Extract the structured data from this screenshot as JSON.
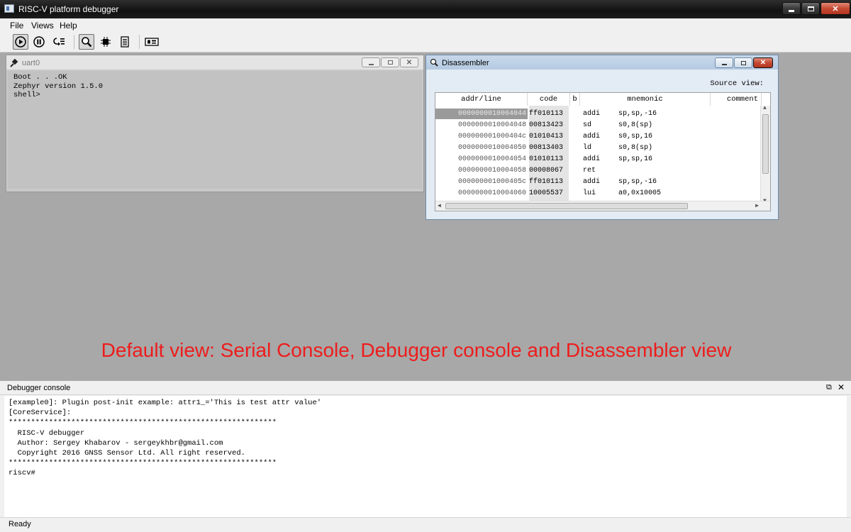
{
  "window": {
    "title": "RISC-V platform debugger"
  },
  "menu": [
    "File",
    "Views",
    "Help"
  ],
  "toolbar": {
    "buttons": [
      {
        "icon": "run-icon",
        "pressed": true
      },
      {
        "icon": "pause-icon",
        "pressed": false
      },
      {
        "icon": "step-into-icon",
        "pressed": false
      },
      {
        "icon": "magnifier-icon",
        "pressed": true
      },
      {
        "icon": "cpu-chip-icon",
        "pressed": false
      },
      {
        "icon": "memory-icon",
        "pressed": false
      },
      {
        "icon": "gnss-board-icon",
        "pressed": false
      }
    ]
  },
  "uart": {
    "title": "uart0",
    "lines": [
      "Boot . . .OK",
      "Zephyr version 1.5.0",
      "shell>"
    ]
  },
  "disassembler": {
    "title": "Disassembler",
    "source_view_label": "Source view:",
    "columns": [
      "addr/line",
      "code",
      "b",
      "mnemonic",
      "comment"
    ],
    "rows": [
      {
        "addr": "0000000010004044",
        "code": "ff010113",
        "mnem": "addi",
        "ops": "sp,sp,-16",
        "selected": true
      },
      {
        "addr": "0000000010004048",
        "code": "00813423",
        "mnem": "sd",
        "ops": "s0,8(sp)"
      },
      {
        "addr": "000000001000404c",
        "code": "01010413",
        "mnem": "addi",
        "ops": "s0,sp,16"
      },
      {
        "addr": "0000000010004050",
        "code": "00813403",
        "mnem": "ld",
        "ops": "s0,8(sp)"
      },
      {
        "addr": "0000000010004054",
        "code": "01010113",
        "mnem": "addi",
        "ops": "sp,sp,16"
      },
      {
        "addr": "0000000010004058",
        "code": "00008067",
        "mnem": "ret",
        "ops": ""
      },
      {
        "addr": "000000001000405c",
        "code": "ff010113",
        "mnem": "addi",
        "ops": "sp,sp,-16"
      },
      {
        "addr": "0000000010004060",
        "code": "10005537",
        "mnem": "lui",
        "ops": "a0,0x10005"
      }
    ]
  },
  "banner": "Default view: Serial Console, Debugger console  and Disassembler view",
  "console": {
    "title": "Debugger console",
    "lines": [
      "[example0]: Plugin post-init example: attr1_='This is test attr value'",
      "[CoreService]:",
      "************************************************************",
      "  RISC-V debugger",
      "  Author: Sergey Khabarov - sergeykhbr@gmail.com",
      "  Copyright 2016 GNSS Sensor Ltd. All right reserved.",
      "************************************************************",
      "riscv#"
    ]
  },
  "status": "Ready",
  "colors": {
    "banner": "#ee1c1c",
    "mdi_background": "#a8a8a8",
    "selection": "#9a9a9a"
  }
}
